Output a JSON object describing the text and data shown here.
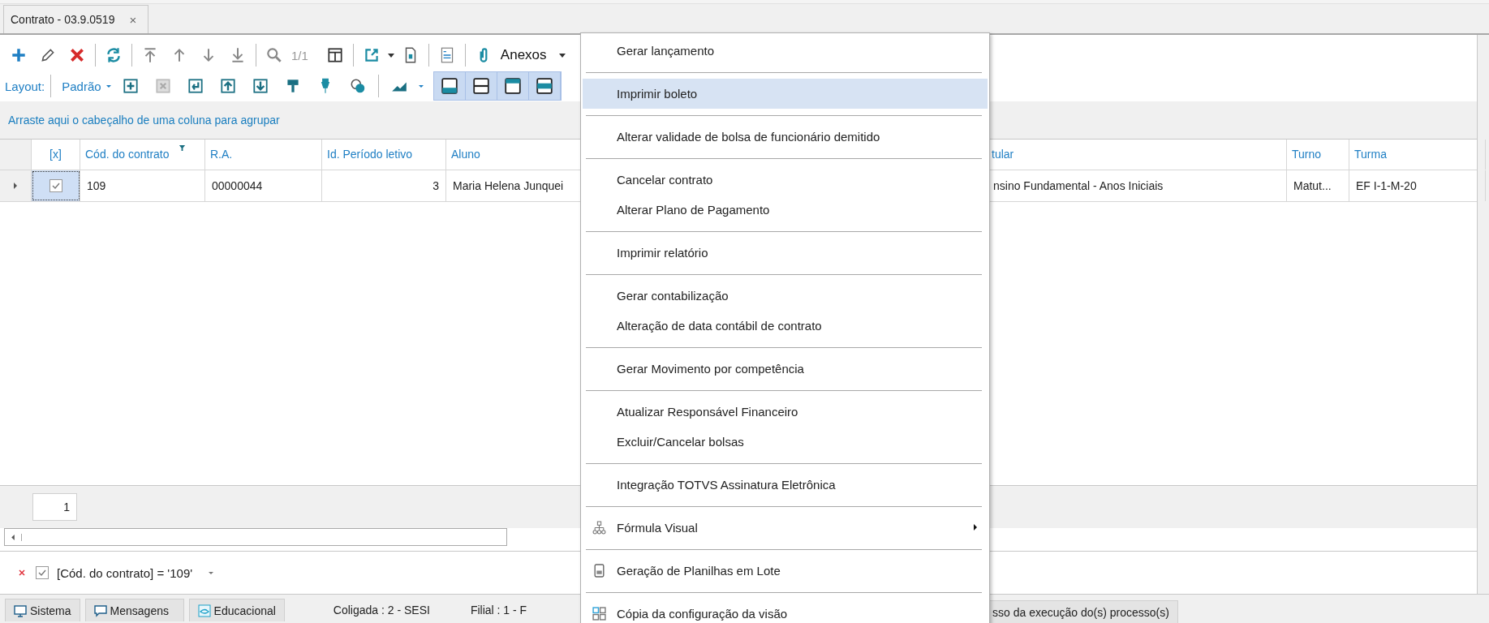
{
  "tab": {
    "title": "Contrato - 03.9.0519",
    "close": "×"
  },
  "toolbar": {
    "pager": "1/1",
    "attachments": "Anexos",
    "layout_label": "Layout:",
    "layout_value": "Padrão",
    "layout_toggles": [
      {
        "selected": true
      },
      {
        "selected": true
      },
      {
        "selected": true
      },
      {
        "selected": true
      }
    ]
  },
  "group_panel": {
    "hint": "Arraste aqui o cabeçalho de uma coluna para agrupar"
  },
  "table": {
    "columns": [
      {
        "label": "[x]",
        "filtered": false
      },
      {
        "label": "Cód. do contrato",
        "filtered": true
      },
      {
        "label": "R.A.",
        "filtered": false
      },
      {
        "label": "Id. Período letivo",
        "filtered": false
      },
      {
        "label": "Aluno",
        "filtered": false
      },
      {
        "label": "tular",
        "filtered": false
      },
      {
        "label": "Turno",
        "filtered": false
      },
      {
        "label": "Turma",
        "filtered": false
      }
    ],
    "rows": [
      {
        "selected": true,
        "checked": true,
        "cells": [
          "",
          "109",
          "00000044",
          "3",
          "Maria Helena Junquei",
          "nsino Fundamental - Anos Iniciais",
          "Matut...",
          "EF I-1-M-20"
        ]
      }
    ]
  },
  "footer": {
    "count": "1"
  },
  "filter": {
    "checked": true,
    "expression": "[Cód. do contrato] = '109'"
  },
  "status_bar": [
    {
      "kind": "button",
      "label": "Sistema"
    },
    {
      "kind": "button",
      "label": "Mensagens"
    },
    {
      "kind": "button",
      "label": "Educacional"
    },
    {
      "kind": "text",
      "label": "Coligada : 2 - SESI"
    },
    {
      "kind": "text",
      "label": "Filial : 1 - F"
    },
    {
      "kind": "button",
      "label": "sso da execução do(s) processo(s)"
    }
  ],
  "context_menu": [
    {
      "kind": "item",
      "label": "Gerar lançamento",
      "selected": false,
      "submenu": false
    },
    {
      "kind": "separator"
    },
    {
      "kind": "item",
      "label": "Imprimir boleto",
      "selected": true,
      "submenu": false
    },
    {
      "kind": "separator"
    },
    {
      "kind": "item",
      "label": "Alterar validade de bolsa de funcionário demitido",
      "selected": false,
      "submenu": false
    },
    {
      "kind": "separator"
    },
    {
      "kind": "item",
      "label": "Cancelar contrato",
      "selected": false,
      "submenu": false
    },
    {
      "kind": "item",
      "label": "Alterar Plano de Pagamento",
      "selected": false,
      "submenu": false
    },
    {
      "kind": "separator"
    },
    {
      "kind": "item",
      "label": "Imprimir relatório",
      "selected": false,
      "submenu": false
    },
    {
      "kind": "separator"
    },
    {
      "kind": "item",
      "label": "Gerar contabilização",
      "selected": false,
      "submenu": false
    },
    {
      "kind": "item",
      "label": "Alteração de data contábil de contrato",
      "selected": false,
      "submenu": false
    },
    {
      "kind": "separator"
    },
    {
      "kind": "item",
      "label": "Gerar Movimento por competência",
      "selected": false,
      "submenu": false
    },
    {
      "kind": "separator"
    },
    {
      "kind": "item",
      "label": "Atualizar Responsável Financeiro",
      "selected": false,
      "submenu": false
    },
    {
      "kind": "item",
      "label": "Excluir/Cancelar bolsas",
      "selected": false,
      "submenu": false
    },
    {
      "kind": "separator"
    },
    {
      "kind": "item",
      "label": "Integração TOTVS Assinatura Eletrônica",
      "selected": false,
      "submenu": false
    },
    {
      "kind": "separator"
    },
    {
      "kind": "item",
      "label": "Fórmula Visual",
      "selected": false,
      "submenu": true
    },
    {
      "kind": "separator"
    },
    {
      "kind": "item",
      "label": "Geração de Planilhas em Lote",
      "selected": false,
      "submenu": false
    },
    {
      "kind": "separator"
    },
    {
      "kind": "item",
      "label": "Cópia da configuração da visão",
      "selected": false,
      "submenu": false
    }
  ]
}
